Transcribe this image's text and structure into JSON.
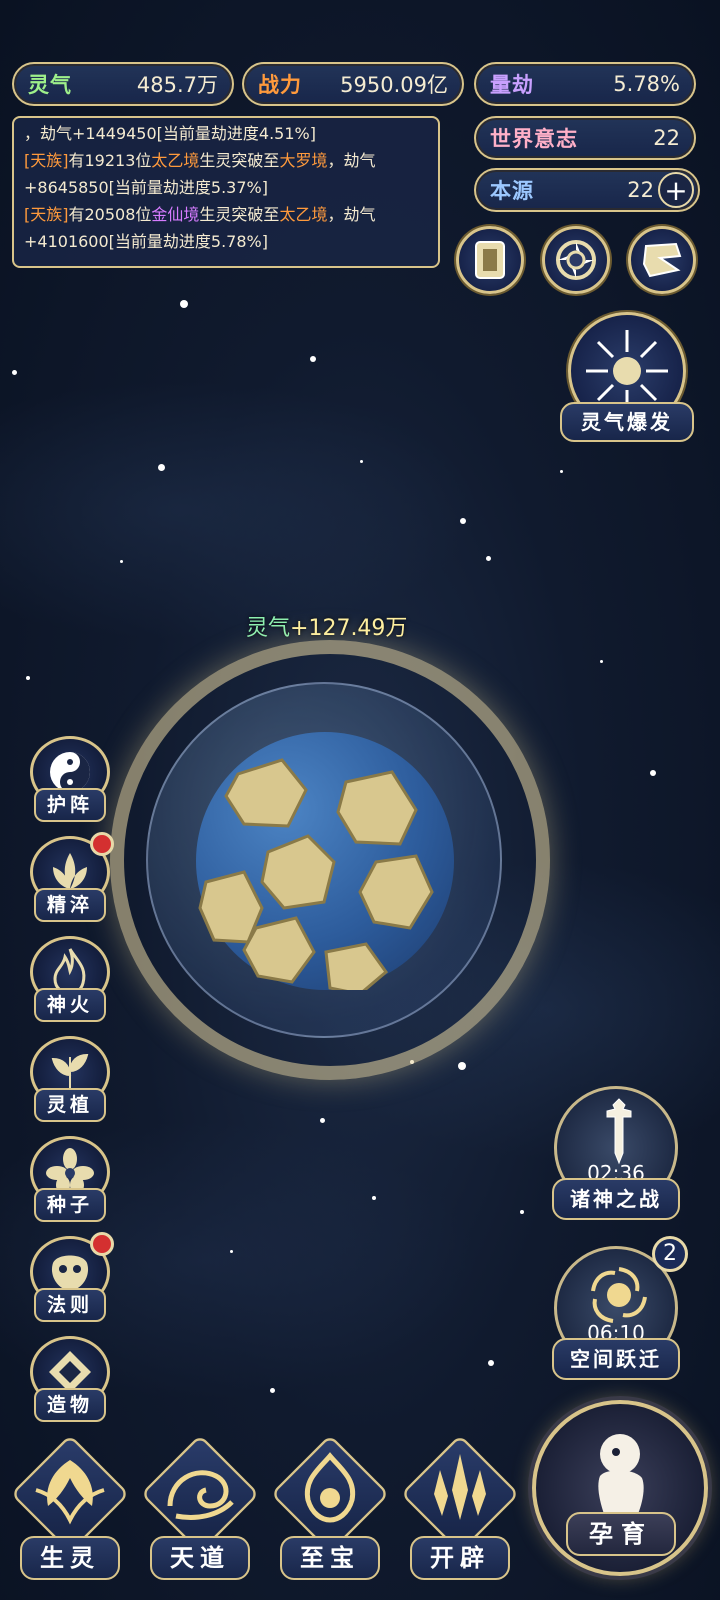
{
  "stats": {
    "lingqi": {
      "label": "灵气",
      "value": "485.7万"
    },
    "zhanli": {
      "label": "战力",
      "value": "5950.09亿"
    },
    "liangjie": {
      "label": "量劫",
      "value": "5.78%"
    },
    "shijie": {
      "label": "世界意志",
      "value": "22"
    },
    "benyuan": {
      "label": "本源",
      "value": "22",
      "plus": "+"
    }
  },
  "log": {
    "line0": "，劫气+1449450[当前量劫进度4.51%]",
    "entry1": {
      "tribe": "[天族]",
      "pre": "有19213位",
      "realm": "太乙境",
      "mid": "生灵突破至",
      "to": "大罗境",
      "post": "，劫气+8645850[当前量劫进度5.37%]"
    },
    "entry2": {
      "tribe": "[天族]",
      "pre": "有20508位",
      "realm": "金仙境",
      "mid": "生灵突破至",
      "to": "太乙境",
      "post": "，劫气+4101600[当前量劫进度5.78%]"
    }
  },
  "burst": {
    "label": "灵气爆发"
  },
  "floating": {
    "key": "灵气",
    "value": "+127.49万"
  },
  "side_menu": [
    {
      "label": "护阵"
    },
    {
      "label": "精淬"
    },
    {
      "label": "神火"
    },
    {
      "label": "灵植"
    },
    {
      "label": "种子"
    },
    {
      "label": "法则"
    },
    {
      "label": "造物"
    }
  ],
  "events": {
    "war": {
      "label": "诸神之战",
      "timer": "02:36"
    },
    "jump": {
      "label": "空间跃迁",
      "timer": "06:10",
      "badge": "2"
    }
  },
  "bottom_nav": [
    {
      "label": "生灵"
    },
    {
      "label": "天道"
    },
    {
      "label": "至宝"
    },
    {
      "label": "开辟"
    }
  ],
  "breed": {
    "label": "孕育"
  },
  "colors": {
    "gold": "#d8c48a",
    "panel": "#18264a",
    "orange": "#ff9a3c",
    "purple": "#d67cff",
    "badge_red": "#d43030"
  }
}
